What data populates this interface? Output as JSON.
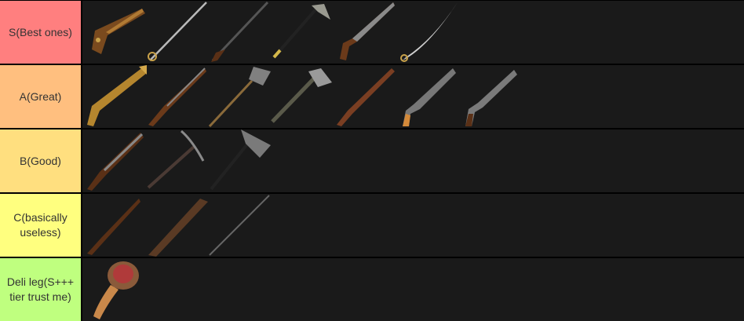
{
  "tiers": [
    {
      "label": "S(Best ones)",
      "color": "#ff7f7f",
      "items": [
        {
          "icon": "flintlock-pistol-gold-icon"
        },
        {
          "icon": "rapier-sword-icon"
        },
        {
          "icon": "long-musket-icon"
        },
        {
          "icon": "boarding-axe-icon"
        },
        {
          "icon": "flintlock-pistol-icon"
        },
        {
          "icon": "cutlass-saber-icon"
        }
      ]
    },
    {
      "label": "A(Great)",
      "color": "#ffbf7f",
      "items": [
        {
          "icon": "blunderbuss-icon"
        },
        {
          "icon": "musket-icon"
        },
        {
          "icon": "shovel-icon"
        },
        {
          "icon": "hatchet-icon"
        },
        {
          "icon": "rifle-icon"
        },
        {
          "icon": "pistol-icon"
        },
        {
          "icon": "dueling-pistol-icon"
        }
      ]
    },
    {
      "label": "B(Good)",
      "color": "#ffdf7f",
      "items": [
        {
          "icon": "shotgun-icon"
        },
        {
          "icon": "pickaxe-icon"
        },
        {
          "icon": "war-axe-icon"
        }
      ]
    },
    {
      "label": "C(basically\nuseless)",
      "color": "#ffff7f",
      "items": [
        {
          "icon": "old-musket-icon"
        },
        {
          "icon": "wooden-club-icon"
        },
        {
          "icon": "spear-icon"
        }
      ]
    },
    {
      "label": "Deli leg(S+++\ntier trust me)",
      "color": "#bfff7f",
      "items": [
        {
          "icon": "ham-leg-icon"
        }
      ]
    }
  ]
}
